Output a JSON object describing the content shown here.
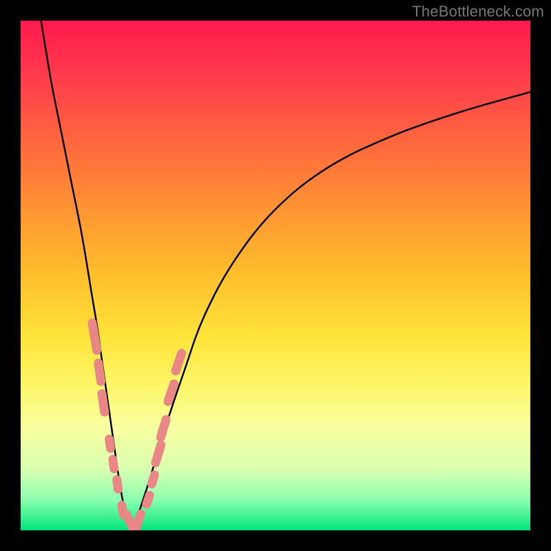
{
  "watermark": "TheBottleneck.com",
  "colors": {
    "frame": "#000000",
    "curve": "#000000",
    "marker": "#e98787",
    "gradient_top": "#ff1a4d",
    "gradient_bottom": "#00e57a"
  },
  "chart_data": {
    "type": "line",
    "title": "",
    "xlabel": "",
    "ylabel": "",
    "xlim": [
      0,
      100
    ],
    "ylim": [
      0,
      100
    ],
    "grid": false,
    "note": "Two curved branches descending to a common minimum near x≈20, forming a V shape. Left branch: x∈[4,22], right branch: x∈[22,100]. y-axis value ≈ bottleneck percentage (0 at bottom/green, 100 at top/red).",
    "series": [
      {
        "name": "left_branch",
        "x": [
          4,
          6,
          8,
          10,
          12,
          14,
          15,
          16,
          17,
          18,
          19,
          20,
          21,
          22
        ],
        "y": [
          100,
          88,
          78,
          68,
          58,
          46,
          40,
          33,
          26,
          19,
          12,
          6,
          2,
          0
        ]
      },
      {
        "name": "right_branch",
        "x": [
          22,
          25,
          28,
          32,
          36,
          42,
          50,
          60,
          72,
          86,
          100
        ],
        "y": [
          0,
          9,
          19,
          31,
          42,
          53,
          63,
          71,
          77,
          82,
          86
        ]
      }
    ],
    "markers": {
      "name": "highlighted_points",
      "description": "Rounded salmon-colored markers clustered near the trough on both branches",
      "points": [
        {
          "x": 14.5,
          "y": 38,
          "len": 8
        },
        {
          "x": 15.5,
          "y": 31,
          "len": 6
        },
        {
          "x": 16.2,
          "y": 25,
          "len": 6
        },
        {
          "x": 17.5,
          "y": 17,
          "len": 4
        },
        {
          "x": 18.2,
          "y": 13,
          "len": 4
        },
        {
          "x": 19.0,
          "y": 9,
          "len": 4
        },
        {
          "x": 20.0,
          "y": 4,
          "len": 4
        },
        {
          "x": 21.5,
          "y": 1.5,
          "len": 6
        },
        {
          "x": 23.0,
          "y": 1.5,
          "len": 6
        },
        {
          "x": 25.0,
          "y": 6,
          "len": 4
        },
        {
          "x": 26.0,
          "y": 10,
          "len": 4
        },
        {
          "x": 27.0,
          "y": 15,
          "len": 6
        },
        {
          "x": 28.0,
          "y": 20,
          "len": 6
        },
        {
          "x": 29.5,
          "y": 27,
          "len": 6
        },
        {
          "x": 31.0,
          "y": 33,
          "len": 6
        }
      ]
    }
  }
}
